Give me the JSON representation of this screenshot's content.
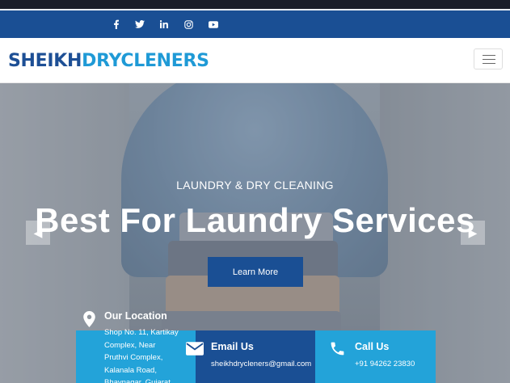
{
  "social": {
    "icons": [
      "facebook-icon",
      "twitter-icon",
      "linkedin-icon",
      "instagram-icon",
      "youtube-icon"
    ],
    "glyphs": [
      "f",
      "✉",
      "in",
      "◎",
      "▶"
    ]
  },
  "navbar": {
    "logo_part1": "SHEIKH",
    "logo_part2": "DRYCLENERS",
    "toggler_icon": "hamburger-menu-icon"
  },
  "hero": {
    "subtitle": "LAUNDRY & DRY CLEANING",
    "headline": "Best For Laundry Services",
    "button_label": "Learn More",
    "prev_icon": "chevron-left-icon",
    "next_icon": "chevron-right-icon",
    "prev_glyph": "◀",
    "next_glyph": "▶"
  },
  "info": {
    "location": {
      "title": "Our Location",
      "lines": [
        "Shop No. 11, Kartikay",
        "Complex, Near",
        "Pruthvi Complex,",
        "Kalanala Road,",
        "Bhavnagar, Gujarat"
      ],
      "icon": "map-pin-icon"
    },
    "email": {
      "title": "Email Us",
      "value": "sheikhdrycleners@gmail.com",
      "icon": "envelope-icon"
    },
    "call": {
      "title": "Call Us",
      "value": "+91 94262 23830",
      "icon": "phone-icon"
    }
  },
  "colors": {
    "primary": "#1a4f94",
    "accent": "#23a3d9",
    "topbar": "#1a1d29"
  }
}
